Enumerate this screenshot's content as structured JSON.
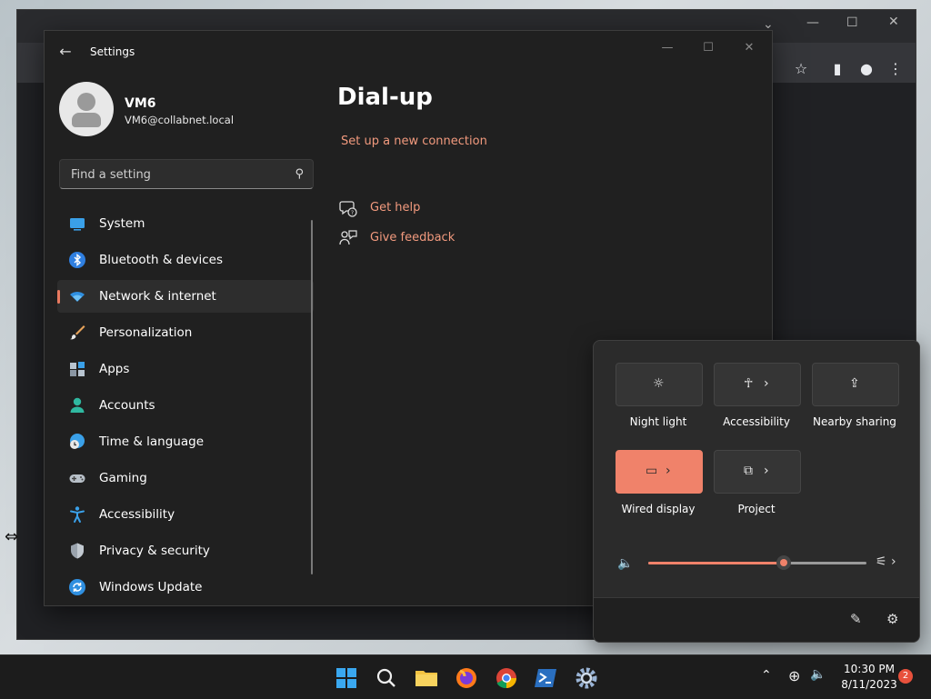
{
  "settings": {
    "app_title": "Settings",
    "user": {
      "name": "VM6",
      "email": "VM6@collabnet.local"
    },
    "search": {
      "placeholder": "Find a setting"
    },
    "nav": [
      {
        "label": "System",
        "icon": "monitor-icon",
        "active": false
      },
      {
        "label": "Bluetooth & devices",
        "icon": "bluetooth-icon",
        "active": false
      },
      {
        "label": "Network & internet",
        "icon": "wifi-icon",
        "active": true
      },
      {
        "label": "Personalization",
        "icon": "brush-icon",
        "active": false
      },
      {
        "label": "Apps",
        "icon": "apps-icon",
        "active": false
      },
      {
        "label": "Accounts",
        "icon": "person-icon",
        "active": false
      },
      {
        "label": "Time & language",
        "icon": "globe-clock-icon",
        "active": false
      },
      {
        "label": "Gaming",
        "icon": "gamepad-icon",
        "active": false
      },
      {
        "label": "Accessibility",
        "icon": "accessibility-icon",
        "active": false
      },
      {
        "label": "Privacy & security",
        "icon": "shield-icon",
        "active": false
      },
      {
        "label": "Windows Update",
        "icon": "update-icon",
        "active": false
      }
    ],
    "page": {
      "title": "Dial-up",
      "setup_link": "Set up a new connection",
      "get_help": "Get help",
      "give_feedback": "Give feedback"
    }
  },
  "quick_settings": {
    "tiles": [
      {
        "label": "Night light",
        "icon": "night-light-icon",
        "on": false,
        "chevron": false
      },
      {
        "label": "Accessibility",
        "icon": "accessibility-icon",
        "on": false,
        "chevron": true
      },
      {
        "label": "Nearby sharing",
        "icon": "share-icon",
        "on": false,
        "chevron": false
      },
      {
        "label": "Wired display",
        "icon": "cast-icon",
        "on": true,
        "chevron": true
      },
      {
        "label": "Project",
        "icon": "project-icon",
        "on": false,
        "chevron": true
      }
    ],
    "volume_percent": 62
  },
  "taskbar": {
    "apps": [
      "start-icon",
      "search-icon",
      "file-explorer-icon",
      "firefox-icon",
      "chrome-icon",
      "powershell-icon",
      "settings-icon"
    ],
    "time": "10:30 PM",
    "date": "8/11/2023",
    "notification_count": "2"
  },
  "colors": {
    "accent": "#f0826a",
    "link": "#f29a7e"
  }
}
